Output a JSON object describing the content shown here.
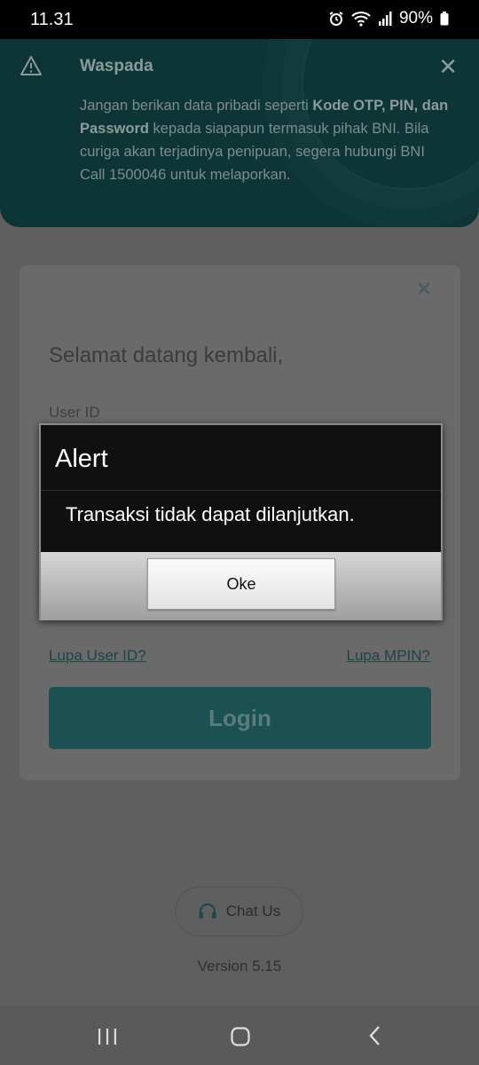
{
  "status": {
    "time": "11.31",
    "battery": "90%",
    "icons": [
      "alarm-icon",
      "wifi-icon",
      "signal-icon",
      "battery-icon"
    ]
  },
  "warning": {
    "title": "Waspada",
    "text_1": "Jangan berikan data pribadi seperti ",
    "text_bold": "Kode OTP, PIN, dan Password",
    "text_2": " kepada siapapun termasuk pihak BNI. Bila curiga akan terjadinya penipuan, segera hubungi BNI Call 1500046 untuk melaporkan."
  },
  "login": {
    "welcome": "Selamat datang kembali,",
    "userid_label": "User ID",
    "forgot_userid": "Lupa User ID?",
    "forgot_mpin": "Lupa MPIN?",
    "login_label": "Login"
  },
  "chat": {
    "label": "Chat Us"
  },
  "version": "Version 5.15",
  "alert": {
    "title": "Alert",
    "message": "Transaksi tidak dapat dilanjutkan.",
    "ok_label": "Oke"
  },
  "colors": {
    "warning_bg": "#0d3535",
    "login_button": "#1b5152",
    "alert_bg": "#101010"
  }
}
